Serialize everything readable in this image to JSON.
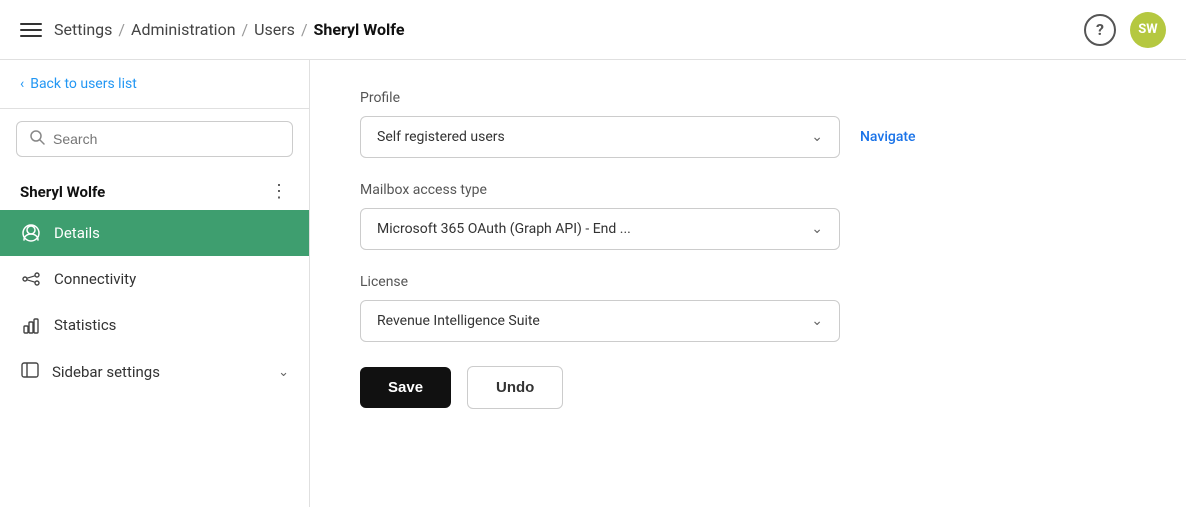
{
  "header": {
    "menu_icon": "hamburger-icon",
    "breadcrumb": [
      {
        "label": "Settings",
        "bold": false
      },
      {
        "sep": "/"
      },
      {
        "label": "Administration",
        "bold": false
      },
      {
        "sep": "/"
      },
      {
        "label": "Users",
        "bold": false
      },
      {
        "sep": "/"
      },
      {
        "label": "Sheryl Wolfe",
        "bold": true
      }
    ],
    "help_label": "?",
    "avatar_initials": "SW"
  },
  "sidebar": {
    "back_label": "Back to users list",
    "search_placeholder": "Search",
    "user_name": "Sheryl Wolfe",
    "nav_items": [
      {
        "id": "details",
        "label": "Details",
        "active": true
      },
      {
        "id": "connectivity",
        "label": "Connectivity",
        "active": false
      },
      {
        "id": "statistics",
        "label": "Statistics",
        "active": false
      },
      {
        "id": "sidebar-settings",
        "label": "Sidebar settings",
        "active": false,
        "expandable": true
      }
    ]
  },
  "main": {
    "profile_label": "Profile",
    "profile_dropdown_value": "Self registered users",
    "navigate_label": "Navigate",
    "mailbox_label": "Mailbox access type",
    "mailbox_dropdown_value": "Microsoft 365 OAuth (Graph API) - End ...",
    "license_label": "License",
    "license_dropdown_value": "Revenue Intelligence Suite",
    "save_label": "Save",
    "undo_label": "Undo"
  }
}
